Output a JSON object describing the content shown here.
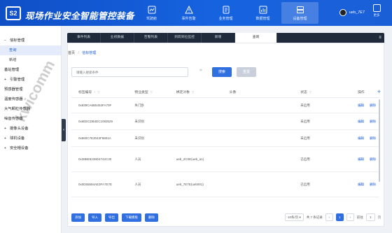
{
  "header": {
    "logo_text": "S2",
    "title": "现场作业安全智能管控装备",
    "nav": [
      {
        "label": "驾驶舱",
        "icon": "dashboard-icon"
      },
      {
        "label": "事件告警",
        "icon": "warning-icon"
      },
      {
        "label": "业务管理",
        "icon": "document-icon"
      },
      {
        "label": "数据管理",
        "icon": "chart-icon"
      },
      {
        "label": "设备管理",
        "icon": "device-icon",
        "active": true
      }
    ],
    "username": "ueb_7E7",
    "more_label": "更多"
  },
  "sidebar": {
    "watermark": "kwicomm",
    "items": [
      {
        "label": "信标管理",
        "caret": "−",
        "level": 0
      },
      {
        "label": "查询",
        "level": 1,
        "selected": true
      },
      {
        "label": "新增",
        "level": 1
      },
      {
        "label": "基站管理",
        "level": 0
      },
      {
        "label": "引警管理",
        "caret": "+",
        "level": 0
      },
      {
        "label": "预感器管理",
        "level": 0
      },
      {
        "label": "温度传感器",
        "level": 0
      },
      {
        "label": "大气颗粒传感器",
        "level": 0
      },
      {
        "label": "噪音传感器",
        "level": 0
      },
      {
        "label": "摄像头设备",
        "caret": "+",
        "level": 0
      },
      {
        "label": "球机设备",
        "caret": "+",
        "level": 0
      },
      {
        "label": "安全帽设备",
        "caret": "+",
        "level": 0
      }
    ]
  },
  "tabs": [
    "事件列表",
    "业机数据",
    "告警列表",
    "到岗到位监控",
    "新增",
    "查询"
  ],
  "breadcrumb": {
    "home": "首页",
    "sep": "/",
    "current": "信标管理"
  },
  "search": {
    "placeholder": "请输入搜索条件"
  },
  "buttons": {
    "query": "搜索",
    "reset": "重置"
  },
  "table": {
    "headers": [
      "标签编号",
      "物业类型",
      "绑定对象",
      "头像",
      "状态",
      "",
      "操作"
    ],
    "edit_label": "编辑",
    "delete_label": "删除",
    "rows": [
      {
        "id": "0x839CA6B5453FA70F",
        "type": "失门卧",
        "bound": "",
        "status": "未启用"
      },
      {
        "id": "0x6EECDB4EC1083529",
        "type": "未识别",
        "bound": "",
        "status": "未启用"
      },
      {
        "id": "0x960C7E3043F6801A",
        "type": "未识别",
        "bound": "",
        "status": "未启用"
      },
      {
        "id": "0x38BE5239D4742C30",
        "type": "人员",
        "bound": "ueb_2C0E(ueb_a1)",
        "status": "已启用"
      },
      {
        "id": "0x0D55594AE3FA7E7E",
        "type": "人员",
        "bound": "ueb_7E7E(ueb001)",
        "status": "已启用"
      }
    ]
  },
  "footer": {
    "buttons": [
      "添加",
      "导入",
      "导出",
      "下载模板",
      "删除"
    ],
    "page_size": "10条/页",
    "total": "共 7 条记录",
    "current_page": "1",
    "goto_label": "前往",
    "goto_value": "1",
    "page_suffix": "页"
  }
}
